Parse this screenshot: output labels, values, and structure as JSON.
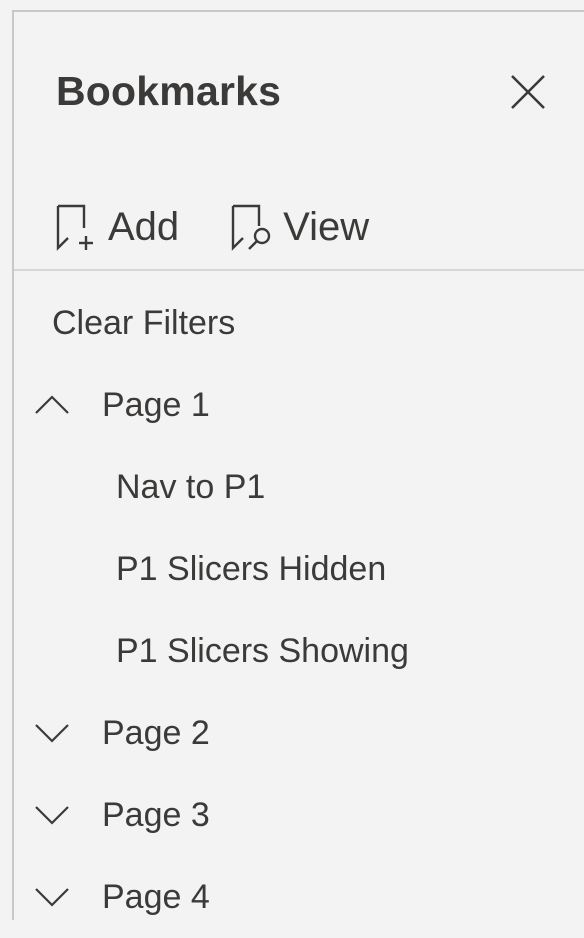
{
  "pane": {
    "title": "Bookmarks",
    "close_icon": "close-icon"
  },
  "toolbar": {
    "add_label": "Add",
    "add_icon": "bookmark-add-icon",
    "view_label": "View",
    "view_icon": "bookmark-view-icon"
  },
  "list": {
    "clear_filters": "Clear Filters",
    "groups": [
      {
        "label": "Page 1",
        "expanded": true,
        "children": [
          "Nav to P1",
          "P1 Slicers Hidden",
          "P1 Slicers Showing"
        ]
      },
      {
        "label": "Page 2",
        "expanded": false
      },
      {
        "label": "Page 3",
        "expanded": false
      },
      {
        "label": "Page 4",
        "expanded": false
      }
    ]
  },
  "colors": {
    "background": "#f3f3f3",
    "text": "#3b3a39",
    "divider": "#d6d6d6"
  }
}
